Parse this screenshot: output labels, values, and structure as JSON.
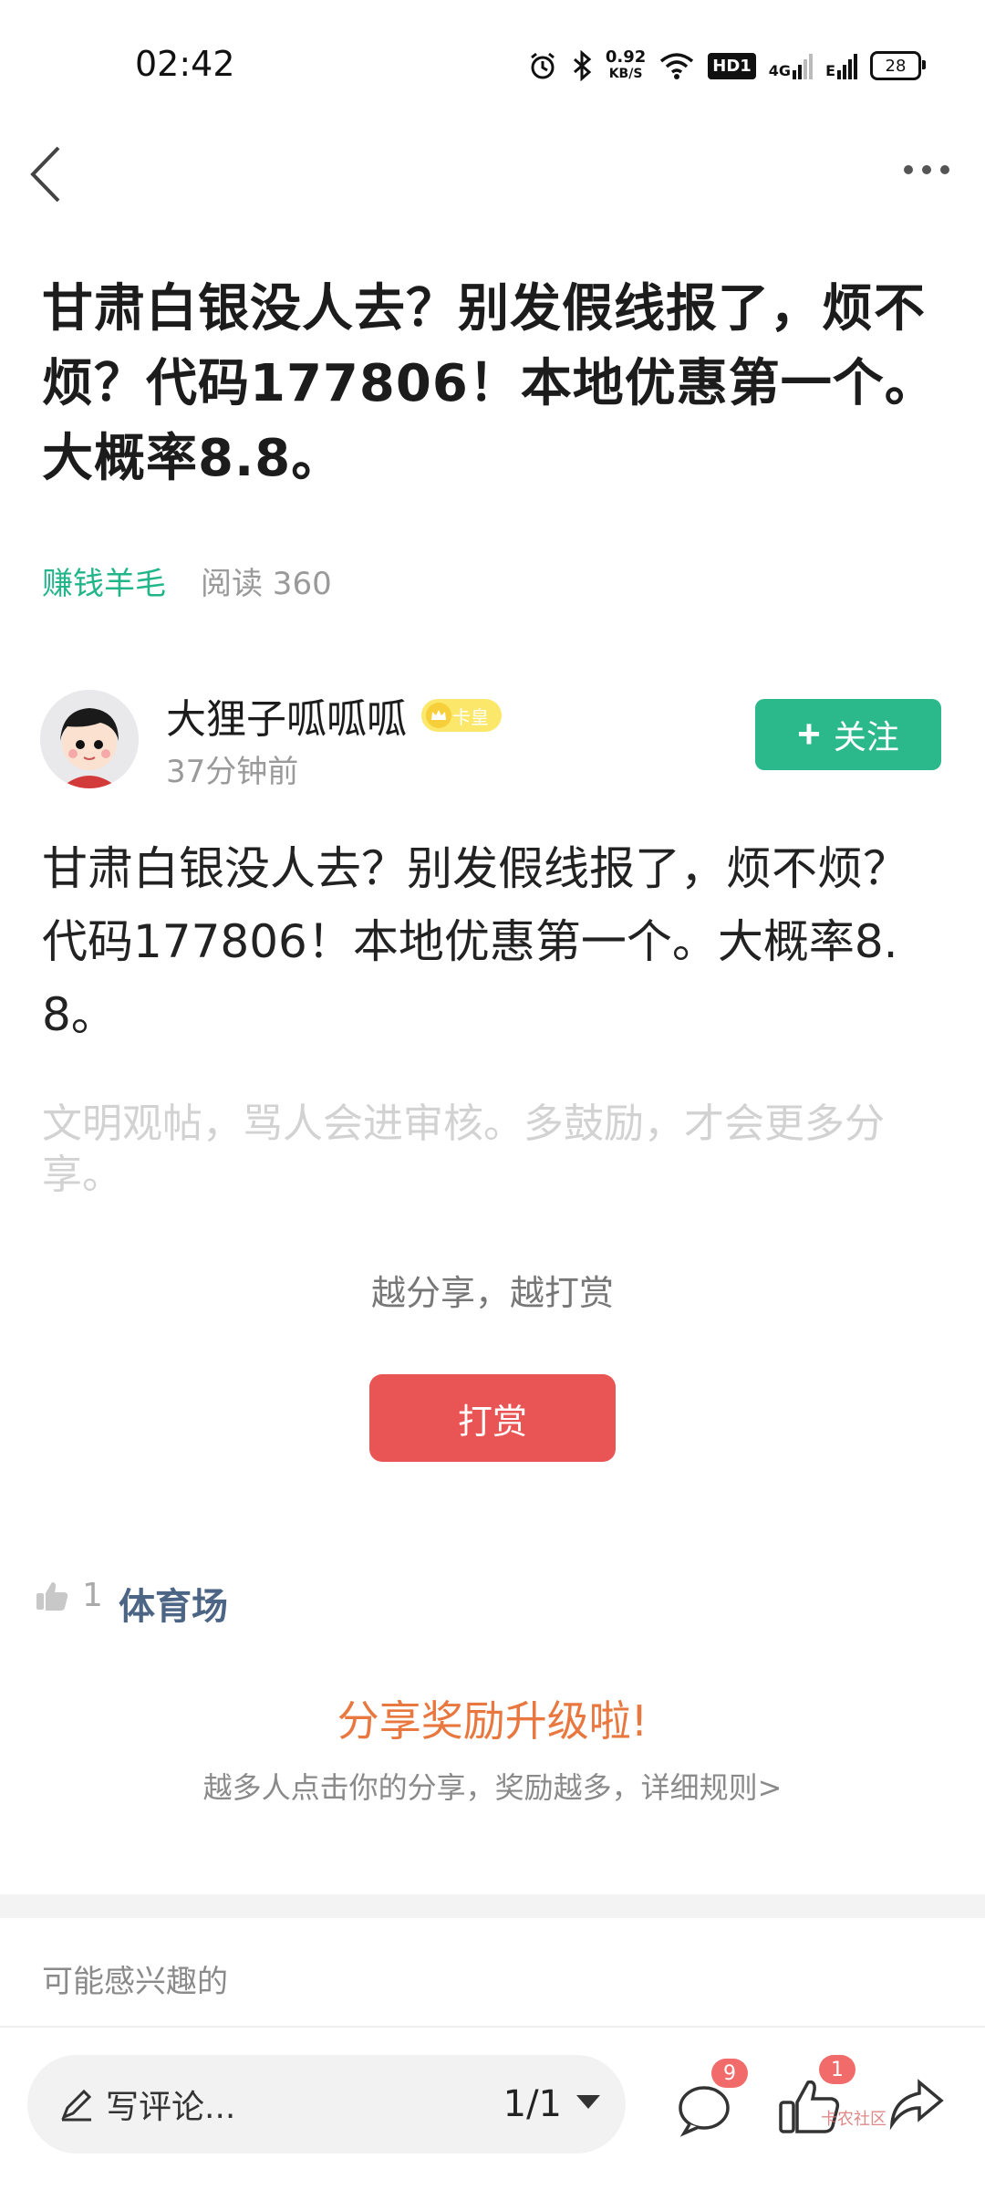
{
  "status": {
    "time": "02:42",
    "net_speed_value": "0.92",
    "net_speed_unit": "KB/S",
    "hd_label": "HD1",
    "net_4g": "4G",
    "net_e": "E",
    "battery": "28"
  },
  "post": {
    "title": "甘肃白银没人去？别发假线报了，烦不烦？代码177806！本地优惠第一个。大概率8.8。",
    "category": "赚钱羊毛",
    "reads": "阅读 360",
    "author": "大狸子呱呱呱",
    "badge": "卡皇",
    "time": "37分钟前",
    "follow_label": "关注",
    "body": "甘肃白银没人去？别发假线报了，烦不烦？代码177806！本地优惠第一个。大概率8.8。",
    "hint": "文明观帖，骂人会进审核。多鼓励，才会更多分享。"
  },
  "reward": {
    "slogan": "越分享，越打赏",
    "button": "打赏"
  },
  "likes": {
    "count": "1",
    "topic": "体育场"
  },
  "promo": {
    "title": "分享奖励升级啦!",
    "subtitle": "越多人点击你的分享，奖励越多，详细规则>"
  },
  "recommend": {
    "label": "可能感兴趣的"
  },
  "bottom_bar": {
    "comment_placeholder": "写评论...",
    "pages": "1/1",
    "comment_count": "9",
    "like_count": "1",
    "watermark": "卡农社区"
  }
}
